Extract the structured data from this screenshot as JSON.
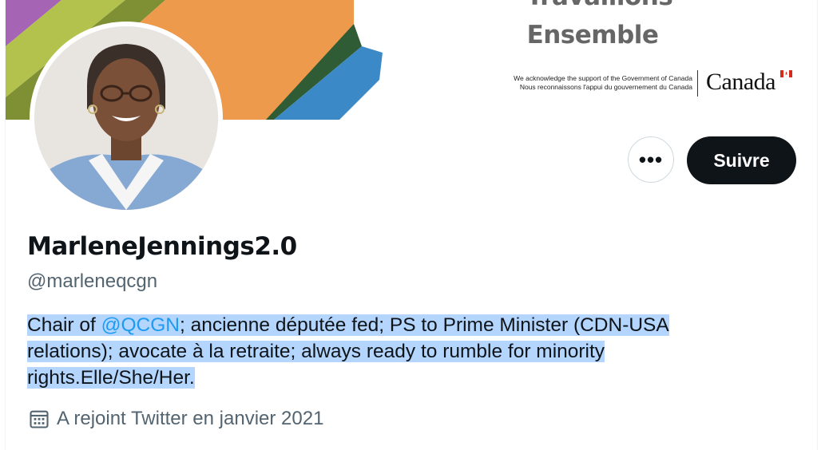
{
  "banner": {
    "title_line1": "Travaillons",
    "title_line2": "Ensemble",
    "ack_en": "We acknowledge the support of the Government of Canada",
    "ack_fr": "Nous reconnaissons l'appui du gouvernement du Canada",
    "wordmark": "Canada"
  },
  "profile": {
    "display_name": "MarleneJennings2.0",
    "handle": "@marleneqcgn",
    "bio": {
      "prefix": "Chair of ",
      "mention": "@QCGN",
      "line1_rest": "; ancienne députée fed; PS to Prime Minister (CDN-USA",
      "line2": "relations); avocate à la retraite; always ready to rumble for minority",
      "line3": "rights.Elle/She/Her."
    },
    "joined": "A rejoint Twitter en janvier 2021"
  },
  "actions": {
    "more_label": "•••",
    "follow_label": "Suivre"
  },
  "icons": {
    "more": "more-icon",
    "calendar": "calendar-icon"
  },
  "colors": {
    "accent": "#1d9bf0",
    "follow_bg": "#0f1419",
    "selection": "#b4d5fe"
  }
}
